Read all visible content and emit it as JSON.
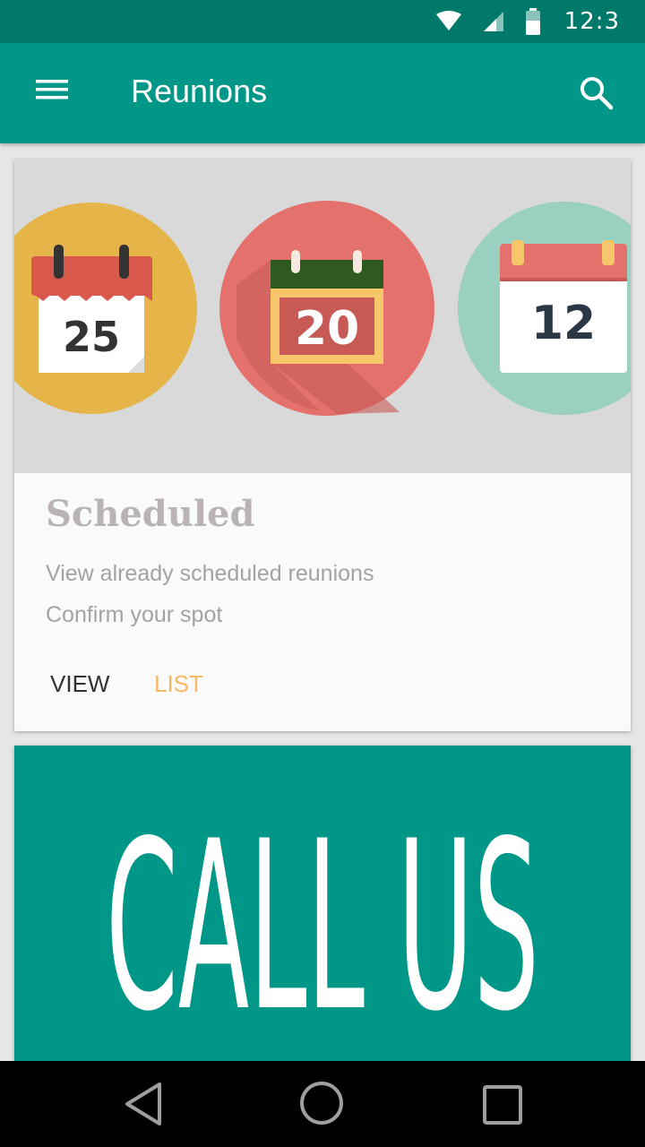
{
  "status_bar": {
    "time": "12:3",
    "icons": [
      "wifi-icon",
      "signal-icon",
      "battery-icon"
    ]
  },
  "app_bar": {
    "title": "Reunions",
    "menu_icon": "hamburger-menu-icon",
    "search_icon": "search-icon",
    "color": "#009688"
  },
  "scheduled_card": {
    "calendars": [
      {
        "day": "25",
        "circle_color": "#e6b54a",
        "icon": "calendar-icon"
      },
      {
        "day": "20",
        "circle_color": "#e4716b",
        "icon": "calendar-icon"
      },
      {
        "day": "12",
        "circle_color": "#99d0bf",
        "icon": "calendar-icon"
      }
    ],
    "title": "Scheduled",
    "lines": [
      "View already scheduled reunions",
      "Confirm your spot"
    ],
    "actions": {
      "view": "VIEW",
      "list": "LIST"
    },
    "list_color": "#f7b968"
  },
  "call_card": {
    "text": "CALL US",
    "background": "#009688"
  },
  "nav_bar": {
    "buttons": [
      "back-icon",
      "home-icon",
      "recents-icon"
    ]
  }
}
